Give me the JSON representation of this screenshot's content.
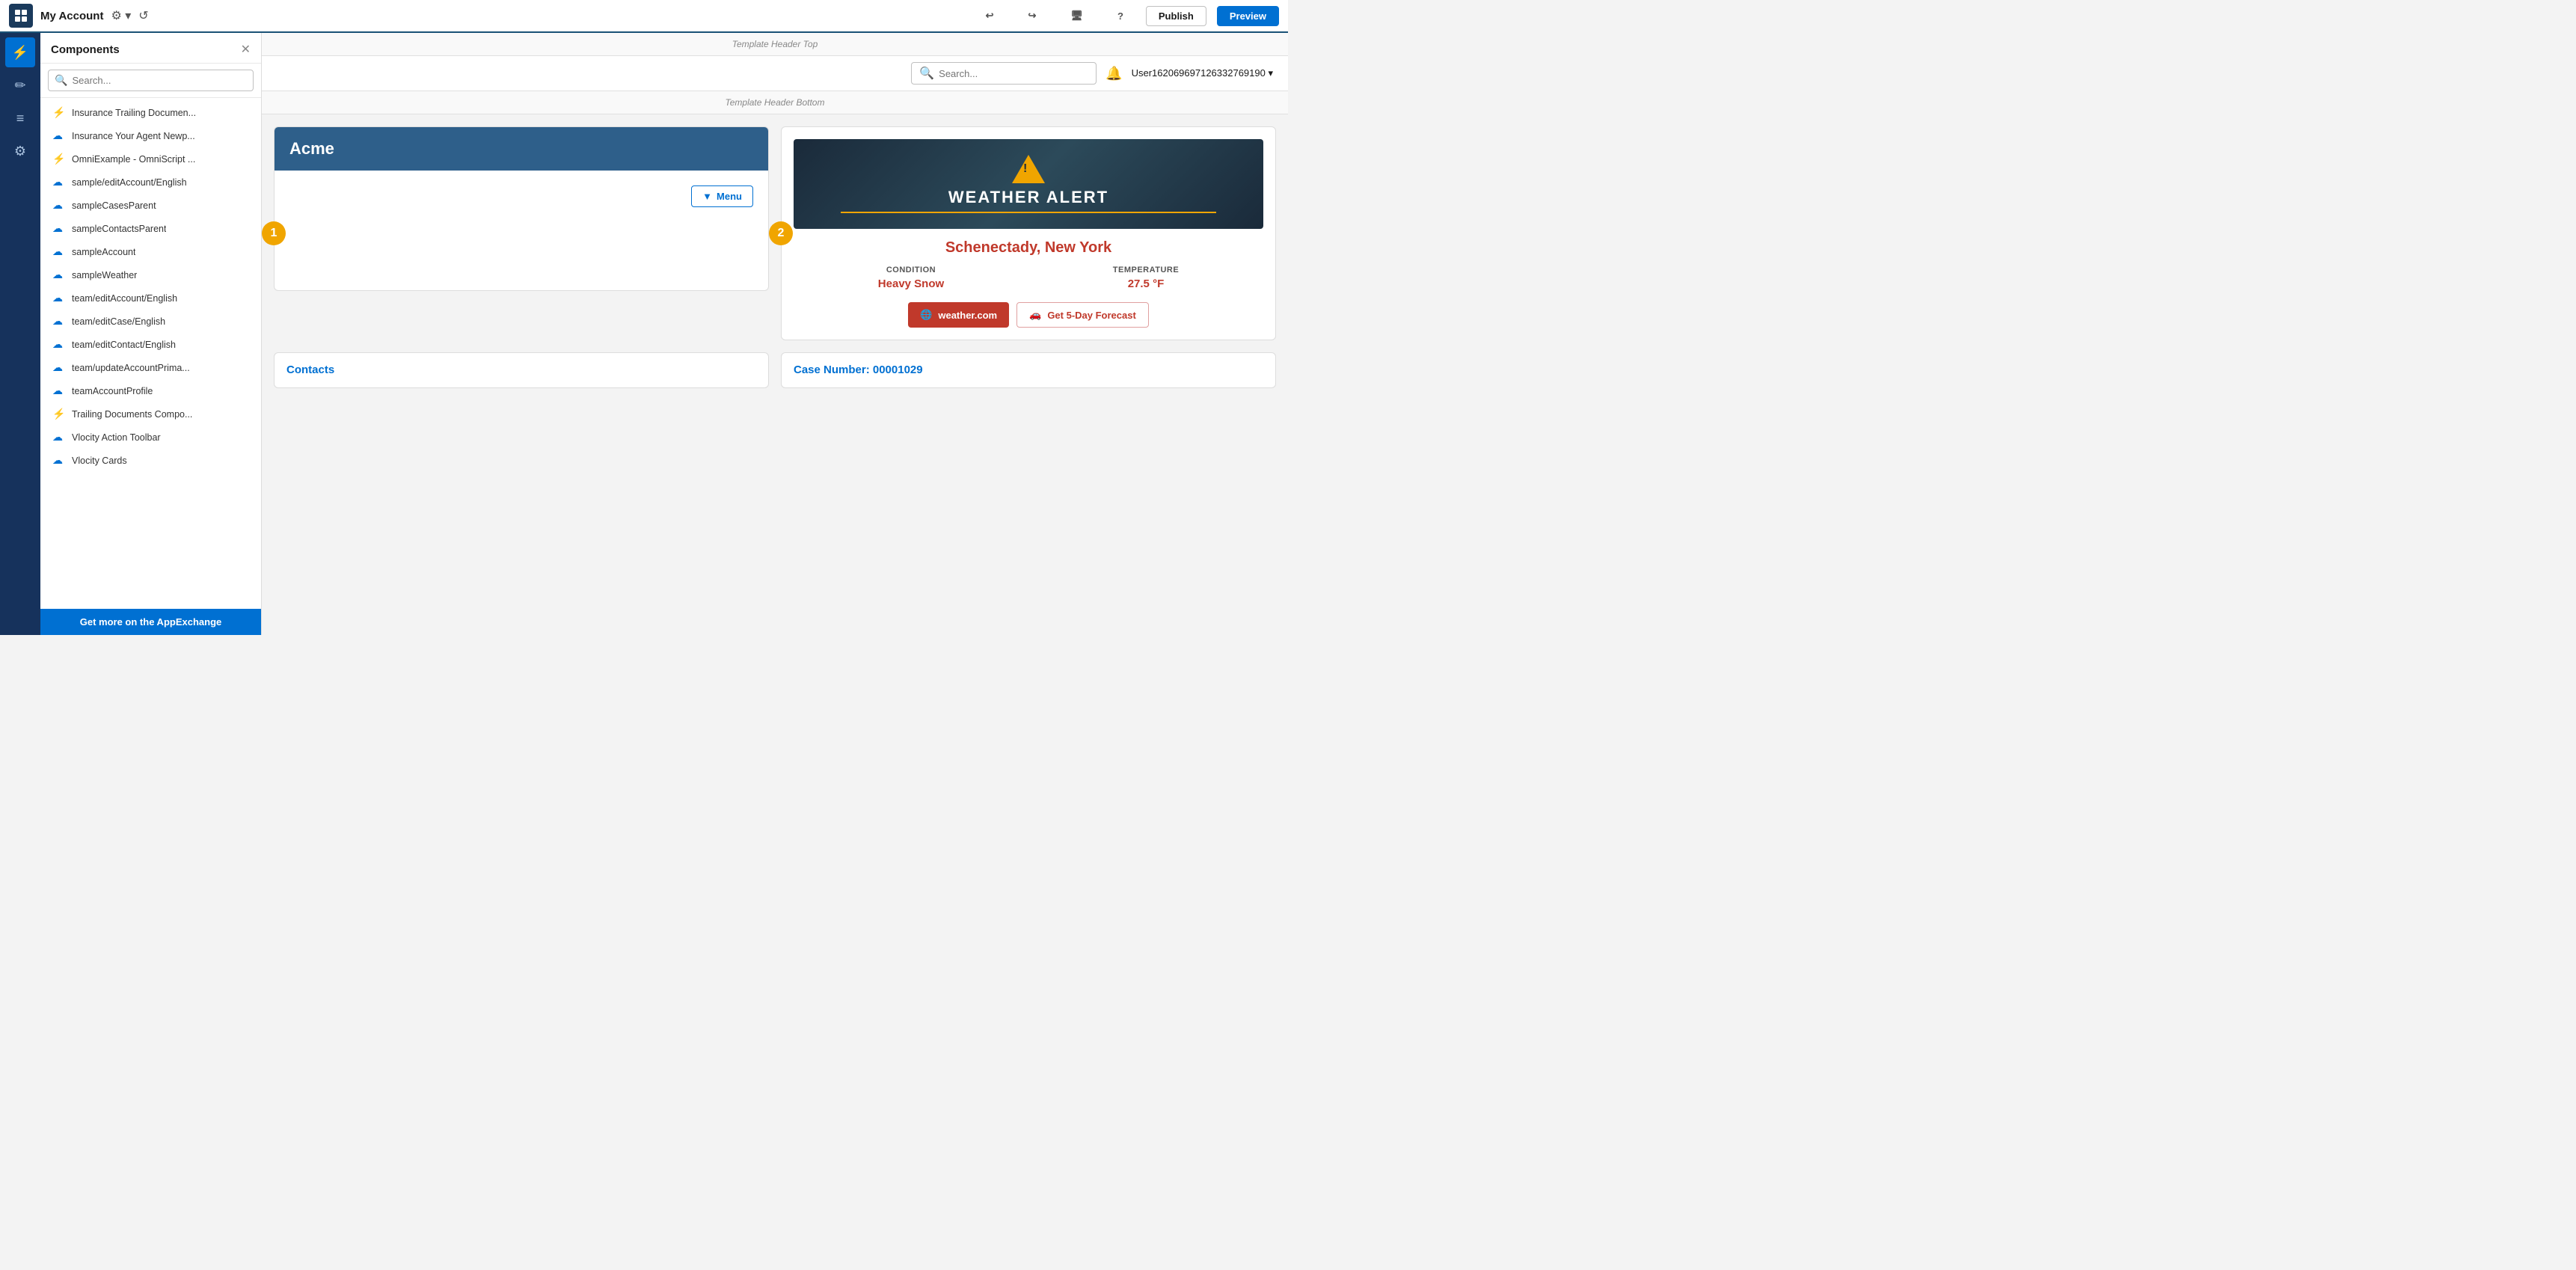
{
  "topbar": {
    "title": "My Account",
    "publish_label": "Publish",
    "preview_label": "Preview"
  },
  "sidebar": {
    "items": [
      {
        "icon": "⚡",
        "name": "lightning",
        "active": true
      },
      {
        "icon": "✏",
        "name": "edit",
        "active": false
      },
      {
        "icon": "≡",
        "name": "menu",
        "active": false
      },
      {
        "icon": "⚙",
        "name": "settings",
        "active": false
      }
    ]
  },
  "components": {
    "title": "Components",
    "search_placeholder": "Search...",
    "items": [
      {
        "name": "Insurance Trailing Documen...",
        "type": "lightning"
      },
      {
        "name": "Insurance Your Agent Newp...",
        "type": "cloud"
      },
      {
        "name": "OmniExample - OmniScript ...",
        "type": "lightning"
      },
      {
        "name": "sample/editAccount/English",
        "type": "cloud"
      },
      {
        "name": "sampleCasesParent",
        "type": "cloud"
      },
      {
        "name": "sampleContactsParent",
        "type": "cloud"
      },
      {
        "name": "sampleAccount",
        "type": "cloud"
      },
      {
        "name": "sampleWeather",
        "type": "cloud"
      },
      {
        "name": "team/editAccount/English",
        "type": "cloud"
      },
      {
        "name": "team/editCase/English",
        "type": "cloud"
      },
      {
        "name": "team/editContact/English",
        "type": "cloud"
      },
      {
        "name": "team/updateAccountPrima...",
        "type": "cloud"
      },
      {
        "name": "teamAccountProfile",
        "type": "cloud"
      },
      {
        "name": "Trailing Documents Compo...",
        "type": "lightning"
      },
      {
        "name": "Vlocity Action Toolbar",
        "type": "cloud"
      },
      {
        "name": "Vlocity Cards",
        "type": "cloud"
      }
    ],
    "footer_label": "Get more on the AppExchange"
  },
  "template": {
    "header_top": "Template Header Top",
    "header_bottom": "Template Header Bottom"
  },
  "nav": {
    "search_placeholder": "Search...",
    "user_label": "User1620696971263327691​90"
  },
  "account_card": {
    "title": "Acme",
    "menu_label": "Menu"
  },
  "weather_card": {
    "alert_text": "WEATHER ALERT",
    "city": "Schenectady, New York",
    "condition_label": "CONDITION",
    "condition_value": "Heavy Snow",
    "temperature_label": "TEMPERATURE",
    "temperature_value": "27.5 °F",
    "weather_com_label": "weather.com",
    "forecast_label": "Get 5-Day Forecast"
  },
  "bottom": {
    "contacts_label": "Contacts",
    "case_label": "Case Number: 00001029"
  },
  "badges": {
    "badge1": "1",
    "badge2": "2"
  }
}
